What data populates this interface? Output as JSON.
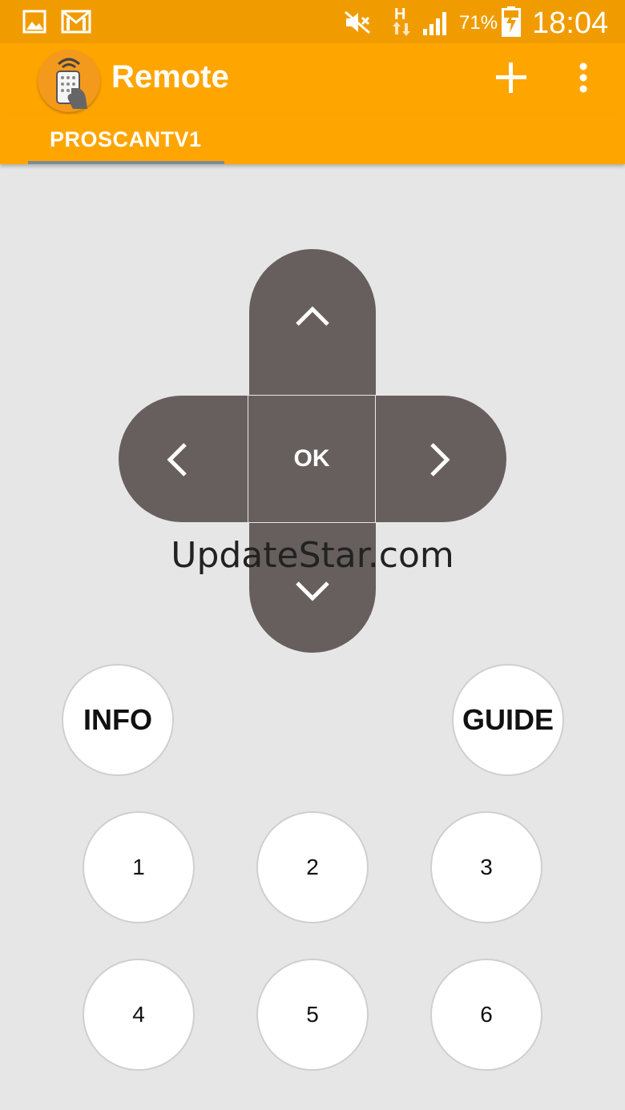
{
  "status_bar": {
    "battery_percent": "71%",
    "time": "18:04",
    "network_type": "H",
    "icons": [
      "gallery-icon",
      "gmail-icon",
      "mute-icon",
      "network-h-icon",
      "signal-icon",
      "battery-charging-icon"
    ]
  },
  "action_bar": {
    "title": "Remote",
    "icons": [
      "remote-app-logo-icon",
      "add-icon",
      "overflow-menu-icon"
    ]
  },
  "tabs": [
    {
      "label": "PROSCANTV1",
      "selected": true
    }
  ],
  "dpad": {
    "ok_label": "OK",
    "icons": [
      "chevron-up-icon",
      "chevron-down-icon",
      "chevron-left-icon",
      "chevron-right-icon"
    ]
  },
  "watermark": "UpdateStar.com",
  "function_buttons": {
    "info": "INFO",
    "guide": "GUIDE"
  },
  "number_buttons": [
    "1",
    "2",
    "3",
    "4",
    "5",
    "6"
  ],
  "colors": {
    "status_bar": "#f09c00",
    "action_bar": "#ffa500",
    "dpad": "#675f5e",
    "background": "#e6e6e6",
    "tab_indicator": "#7f8a96"
  }
}
